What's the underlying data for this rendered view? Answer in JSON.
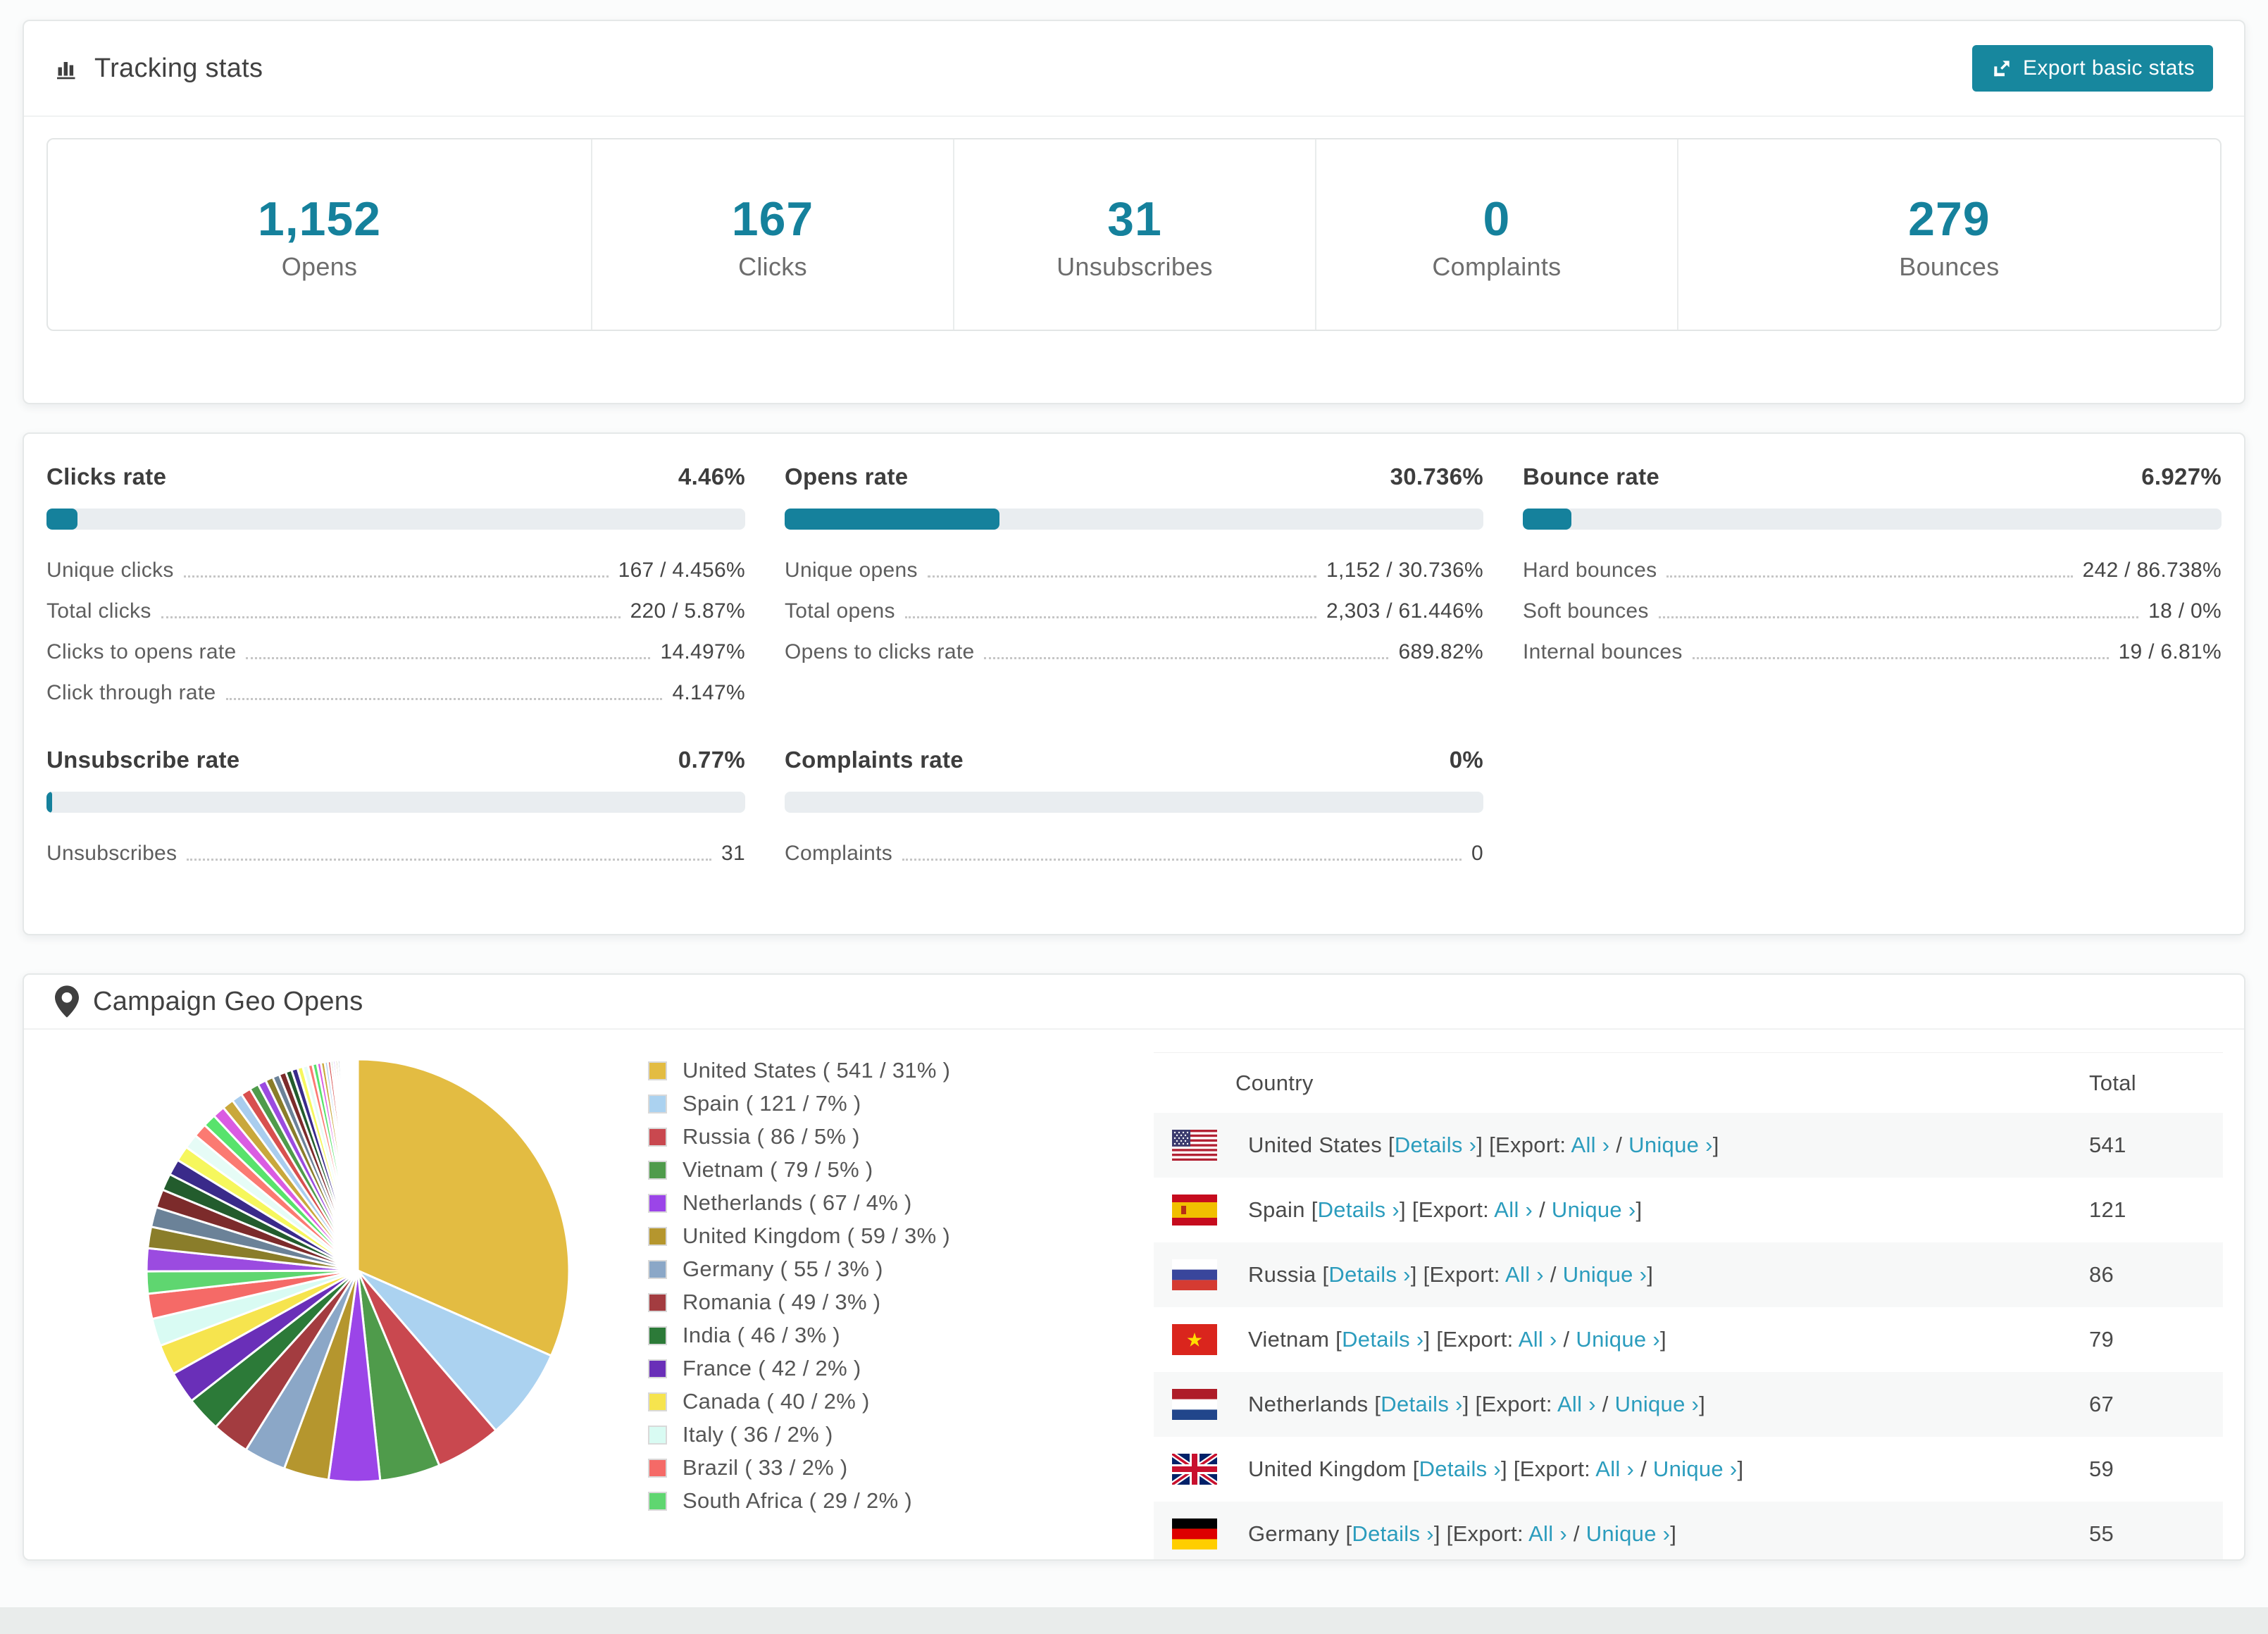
{
  "accent": {
    "teal": "#15819c",
    "button_teal": "#17879e",
    "link_teal": "#2b9cbd"
  },
  "tracking": {
    "title": "Tracking stats",
    "export_button": "Export basic stats",
    "boxes": [
      {
        "value": "1,152",
        "label": "Opens"
      },
      {
        "value": "167",
        "label": "Clicks"
      },
      {
        "value": "31",
        "label": "Unsubscribes"
      },
      {
        "value": "0",
        "label": "Complaints"
      },
      {
        "value": "279",
        "label": "Bounces"
      }
    ]
  },
  "rates": {
    "blocks": [
      {
        "title": "Clicks rate",
        "value": "4.46%",
        "bar_pct": 4.46,
        "rows": [
          {
            "label": "Unique clicks",
            "value": "167 / 4.456%"
          },
          {
            "label": "Total clicks",
            "value": "220 / 5.87%"
          },
          {
            "label": "Clicks to opens rate",
            "value": "14.497%"
          },
          {
            "label": "Click through rate",
            "value": "4.147%"
          }
        ]
      },
      {
        "title": "Opens rate",
        "value": "30.736%",
        "bar_pct": 30.736,
        "rows": [
          {
            "label": "Unique opens",
            "value": "1,152 / 30.736%"
          },
          {
            "label": "Total opens",
            "value": "2,303 / 61.446%"
          },
          {
            "label": "Opens to clicks rate",
            "value": "689.82%"
          }
        ]
      },
      {
        "title": "Bounce rate",
        "value": "6.927%",
        "bar_pct": 6.927,
        "rows": [
          {
            "label": "Hard bounces",
            "value": "242 / 86.738%"
          },
          {
            "label": "Soft bounces",
            "value": "18 / 0%"
          },
          {
            "label": "Internal bounces",
            "value": "19 / 6.81%"
          }
        ]
      },
      {
        "title": "Unsubscribe rate",
        "value": "0.77%",
        "bar_pct": 0.77,
        "rows": [
          {
            "label": "Unsubscribes",
            "value": "31"
          }
        ]
      },
      {
        "title": "Complaints rate",
        "value": "0%",
        "bar_pct": 0,
        "rows": [
          {
            "label": "Complaints",
            "value": "0"
          }
        ]
      }
    ]
  },
  "geo": {
    "title": "Campaign Geo Opens",
    "table": {
      "headers": {
        "country": "Country",
        "total": "Total"
      },
      "link_parts": {
        "open": "[",
        "details": "Details ›",
        "mid": "] [Export: ",
        "all": "All ›",
        "slash": " / ",
        "unique": "Unique ›",
        "close": "]"
      },
      "rows": [
        {
          "country": "United States",
          "flag": "us",
          "total": "541"
        },
        {
          "country": "Spain",
          "flag": "es",
          "total": "121"
        },
        {
          "country": "Russia",
          "flag": "ru",
          "total": "86"
        },
        {
          "country": "Vietnam",
          "flag": "vn",
          "total": "79"
        },
        {
          "country": "Netherlands",
          "flag": "nl",
          "total": "67"
        },
        {
          "country": "United Kingdom",
          "flag": "gb",
          "total": "59"
        },
        {
          "country": "Germany",
          "flag": "de",
          "total": "55"
        }
      ]
    }
  },
  "chart_data": {
    "type": "pie",
    "title": "Campaign Geo Opens",
    "start_angle_deg": -90,
    "direction": "clockwise",
    "gap_color": "#ffffff",
    "legend_position": "right",
    "slices": [
      {
        "label": "United States",
        "count": 541,
        "pct": "31%",
        "color": "#e3bc42"
      },
      {
        "label": "Spain",
        "count": 121,
        "pct": "7%",
        "color": "#abd2f0"
      },
      {
        "label": "Russia",
        "count": 86,
        "pct": "5%",
        "color": "#c9484f"
      },
      {
        "label": "Vietnam",
        "count": 79,
        "pct": "5%",
        "color": "#4f9b4b"
      },
      {
        "label": "Netherlands",
        "count": 67,
        "pct": "4%",
        "color": "#9b45e8"
      },
      {
        "label": "United Kingdom",
        "count": 59,
        "pct": "3%",
        "color": "#b5962e"
      },
      {
        "label": "Germany",
        "count": 55,
        "pct": "3%",
        "color": "#8ba7c7"
      },
      {
        "label": "Romania",
        "count": 49,
        "pct": "3%",
        "color": "#a33c40"
      },
      {
        "label": "India",
        "count": 46,
        "pct": "3%",
        "color": "#2c7a38"
      },
      {
        "label": "France",
        "count": 42,
        "pct": "2%",
        "color": "#6a2fb8"
      },
      {
        "label": "Canada",
        "count": 40,
        "pct": "2%",
        "color": "#f6e44e"
      },
      {
        "label": "Italy",
        "count": 36,
        "pct": "2%",
        "color": "#d9fbf3"
      },
      {
        "label": "Brazil",
        "count": 33,
        "pct": "2%",
        "color": "#f56a67"
      },
      {
        "label": "South Africa",
        "count": 29,
        "pct": "2%",
        "color": "#5fd670"
      }
    ],
    "legend_labels": [
      "United States ( 541 / 31% )",
      "Spain ( 121 / 7% )",
      "Russia ( 86 / 5% )",
      "Vietnam ( 79 / 5% )",
      "Netherlands ( 67 / 4% )",
      "United Kingdom ( 59 / 3% )",
      "Germany ( 55 / 3% )",
      "Romania ( 49 / 3% )",
      "India ( 46 / 3% )",
      "France ( 42 / 2% )",
      "Canada ( 40 / 2% )",
      "Italy ( 36 / 2% )",
      "Brazil ( 33 / 2% )",
      "South Africa ( 29 / 2% )"
    ],
    "others": {
      "note": "unlabeled small countries",
      "values": [
        30,
        28,
        26,
        24,
        22,
        21,
        20,
        19,
        18,
        17,
        16,
        15,
        14,
        13,
        12,
        11,
        10,
        9,
        9,
        8,
        8,
        7,
        7,
        6,
        6,
        5,
        5,
        4,
        4,
        3,
        3,
        3,
        3,
        2,
        2,
        2,
        2,
        2,
        2,
        1,
        1,
        1,
        1,
        1,
        1,
        1,
        1,
        1,
        1,
        1
      ],
      "palette": [
        "#9b4be0",
        "#8a7d2a",
        "#6b8298",
        "#7c2b2b",
        "#235c2d",
        "#3a2a8a",
        "#f6f75d",
        "#e6fcf6",
        "#fb7a72",
        "#58e36c",
        "#da5ce2",
        "#c9a83c",
        "#a9cdee",
        "#d8504f",
        "#4f9b4b"
      ]
    }
  }
}
